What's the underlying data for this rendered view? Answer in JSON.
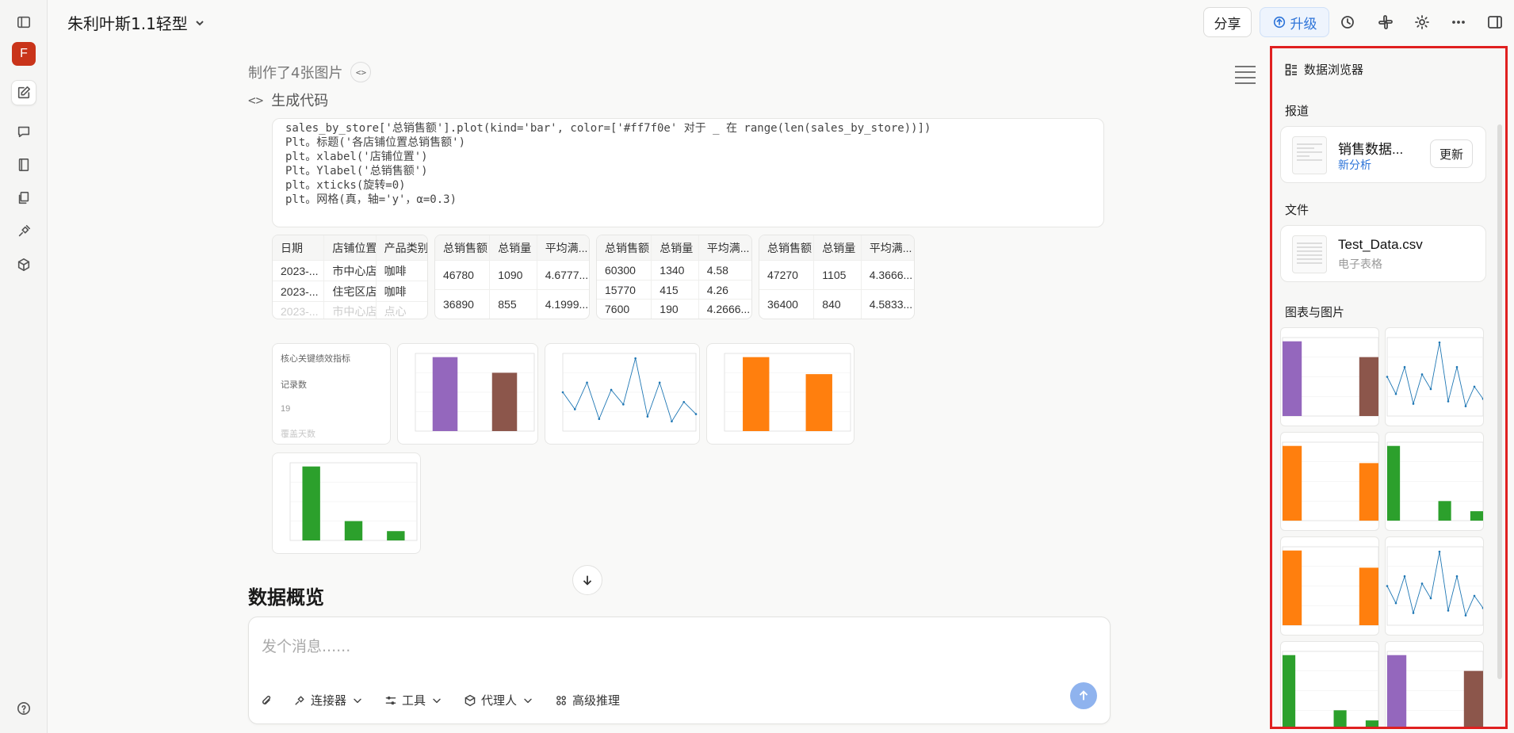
{
  "app": {
    "title": "朱利叶斯1.1轻型",
    "avatar_letter": "F",
    "share_label": "分享",
    "upgrade_label": "升级"
  },
  "thread": {
    "made_label": "制作了4张图片",
    "gen_code_label": "生成代码",
    "code_lines": [
      "sales_by_store['总销售额'].plot(kind='bar', color=['#ff7f0e' 对于 _ 在 range(len(sales_by_store))])",
      "Plt。标题('各店铺位置总销售额')",
      "plt。xlabel('店铺位置')",
      "Plt。Ylabel('总销售额')",
      "plt。xticks(旋转=0)",
      "plt。网格(真，轴='y'，α=0.3)"
    ],
    "overview_heading": "数据概览"
  },
  "tables": {
    "t1": {
      "headers": [
        "日期",
        "店铺位置",
        "产品类别"
      ],
      "rows": [
        [
          "2023-...",
          "市中心店",
          "咖啡"
        ],
        [
          "2023-...",
          "住宅区店",
          "咖啡"
        ],
        [
          "2023-...",
          "市中心店",
          "点心"
        ]
      ]
    },
    "t2": {
      "headers": [
        "总销售额",
        "总销量",
        "平均满..."
      ],
      "rows": [
        [
          "46780",
          "1090",
          "4.6777..."
        ],
        [
          "36890",
          "855",
          "4.1999..."
        ]
      ]
    },
    "t3": {
      "headers": [
        "总销售额",
        "总销量",
        "平均满..."
      ],
      "rows": [
        [
          "60300",
          "1340",
          "4.58"
        ],
        [
          "15770",
          "415",
          "4.26"
        ],
        [
          "7600",
          "190",
          "4.2666..."
        ]
      ]
    },
    "t4": {
      "headers": [
        "总销售额",
        "总销量",
        "平均满..."
      ],
      "rows": [
        [
          "47270",
          "1105",
          "4.3666..."
        ],
        [
          "36400",
          "840",
          "4.5833..."
        ]
      ]
    }
  },
  "kpi": {
    "title": "核心关键绩效指标",
    "label": "记录数",
    "value": "19",
    "next_label": "覆盖天数"
  },
  "composer": {
    "placeholder": "发个消息......",
    "tools": [
      "连接器",
      "工具",
      "代理人",
      "高级推理"
    ]
  },
  "panel": {
    "title": "数据浏览器",
    "reports_label": "报道",
    "report_name": "销售数据...",
    "report_sub": "新分析",
    "update_label": "更新",
    "files_label": "文件",
    "file_name": "Test_Data.csv",
    "file_sub": "电子表格",
    "charts_label": "图表与图片"
  },
  "colors": {
    "purple": "#9467bd",
    "brown": "#8c564b",
    "orange": "#ff7f0e",
    "green": "#2ca02c",
    "line": "#1f77b4",
    "accent": "#2d74d9",
    "highlight": "#e02020"
  },
  "chart_data": [
    {
      "type": "bar",
      "categories": [
        "",
        ""
      ],
      "values": [
        46780,
        36890
      ],
      "colors": [
        "#9467bd",
        "#8c564b"
      ]
    },
    {
      "type": "line",
      "x": [
        1,
        2,
        3,
        4,
        5,
        6,
        7,
        8,
        9,
        10,
        11,
        12
      ],
      "values": [
        1.6,
        0.9,
        2.0,
        0.5,
        1.7,
        1.1,
        3.0,
        0.6,
        2.0,
        0.4,
        1.2,
        0.7
      ]
    },
    {
      "type": "bar",
      "categories": [
        "",
        ""
      ],
      "values": [
        47270,
        36400
      ],
      "colors": [
        "#ff7f0e",
        "#ff7f0e"
      ]
    },
    {
      "type": "bar",
      "categories": [
        "",
        "",
        ""
      ],
      "values": [
        60300,
        15770,
        7600
      ],
      "colors": [
        "#2ca02c",
        "#2ca02c",
        "#2ca02c"
      ]
    }
  ]
}
